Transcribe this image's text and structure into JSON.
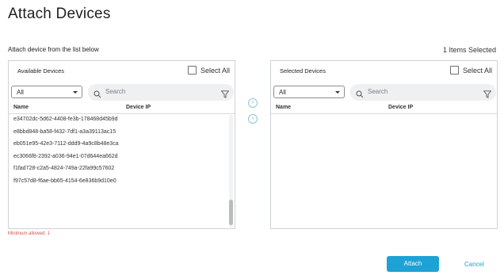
{
  "dialog": {
    "title": "Attach Devices",
    "subtitle": "Attach device from the list below",
    "selected_count": "1 Items Selected",
    "minimum_note": "Minimum allowed: 1"
  },
  "available": {
    "title": "Available Devices",
    "select_all": "Select All",
    "filter_value": "All",
    "search_placeholder": "Search",
    "columns": [
      "Name",
      "Device IP"
    ],
    "rows": [
      {
        "name": "e34702dc-5d62-4408-fe3b-178468d45b9d"
      },
      {
        "name": "e8bbd848-ba58-f432-7df1-a3a39113ac15"
      },
      {
        "name": "eb051e95-42e3-7112-ddd9-4a9c8b48e3ca"
      },
      {
        "name": "ec3066f8-2392-a036-94e1-07d644ea662d"
      },
      {
        "name": "f1fad728-c2a5-4824-749a-22fa99c57602"
      },
      {
        "name": "f97c57d8-f6ae-bb65-4154-6e836b9d10e0"
      }
    ]
  },
  "selected": {
    "title": "Selected Devices",
    "select_all": "Select All",
    "filter_value": "All",
    "search_placeholder": "Search",
    "columns": [
      "Name",
      "Device IP"
    ]
  },
  "actions": {
    "attach": "Attach",
    "cancel": "Cancel",
    "move_right": "›",
    "move_left": "‹"
  },
  "colors": {
    "accent": "#1ea2d6",
    "warning": "#d9534f"
  }
}
